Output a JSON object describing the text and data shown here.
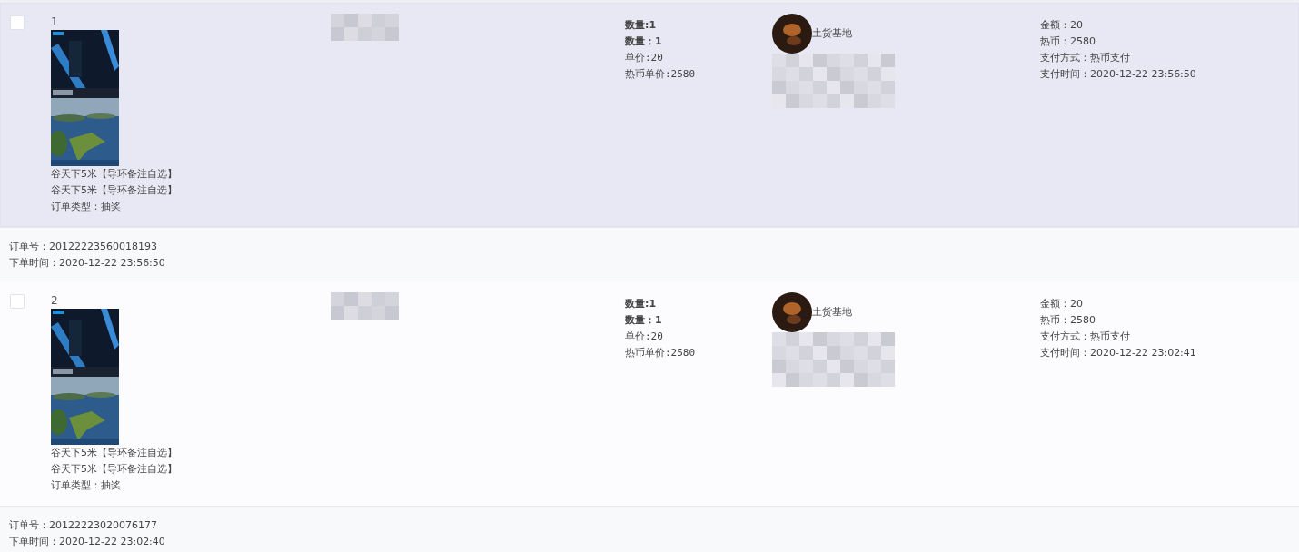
{
  "orders": [
    {
      "index": "1",
      "checked": false,
      "highlighted": true,
      "items": [
        "谷天下5米【导环备注自选】",
        "谷天下5米【导环备注自选】"
      ],
      "order_type": "订单类型：抽奖",
      "quantity_lines": [
        "数量:1",
        "数量：1"
      ],
      "unit_price": "单价:20",
      "coin_unit_price": "热币单价:2580",
      "seller": "土货基地",
      "payment": [
        "金额：20",
        "热币：2580",
        "支付方式：热币支付",
        "支付时间：2020-12-22 23:56:50"
      ],
      "order_no": "订单号：20122223560018193",
      "order_time": "下单时间：2020-12-22 23:56:50"
    },
    {
      "index": "2",
      "checked": false,
      "highlighted": false,
      "items": [
        "谷天下5米【导环备注自选】",
        "谷天下5米【导环备注自选】"
      ],
      "order_type": "订单类型：抽奖",
      "quantity_lines": [
        "数量:1",
        "数量：1"
      ],
      "unit_price": "单价:20",
      "coin_unit_price": "热币单价:2580",
      "seller": "土货基地",
      "payment": [
        "金额：20",
        "热币：2580",
        "支付方式：热币支付",
        "支付时间：2020-12-22 23:02:41"
      ],
      "order_no": "订单号：20122223020076177",
      "order_time": "下单时间：2020-12-22 23:02:40"
    }
  ]
}
